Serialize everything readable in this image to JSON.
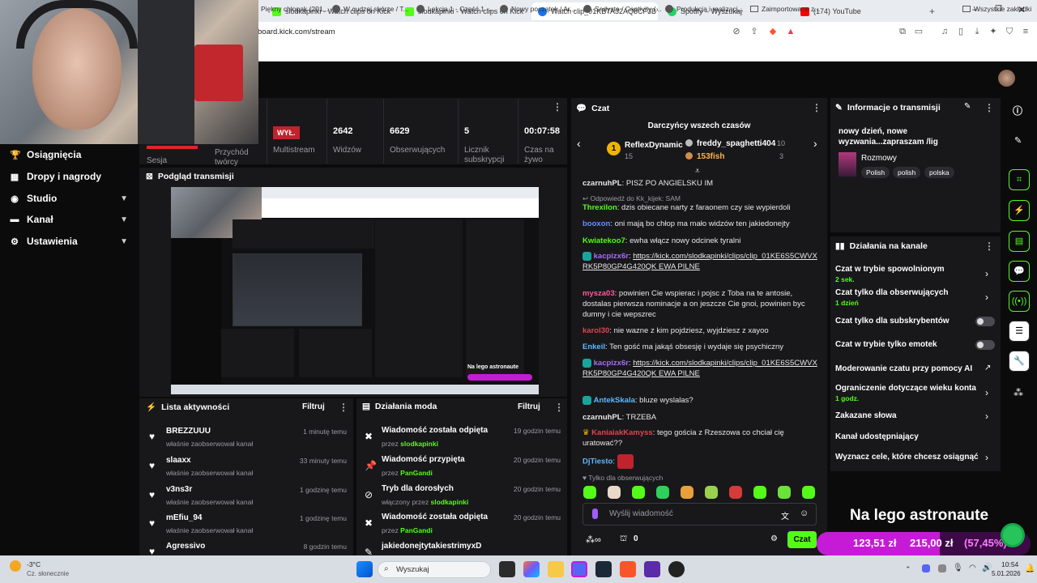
{
  "browser": {
    "tabs": [
      {
        "title": "slodkapinki - Watch clips on Kick"
      },
      {
        "title": "slodkapinki - Watch clips on Kick"
      },
      {
        "title": "Watch clip_01KBTA32AQ8CF3BYY8Z"
      },
      {
        "title": "Spotify – Wyszukaj"
      },
      {
        "title": "(174) YouTube"
      }
    ],
    "url": "board.kick.com/stream",
    "bookmarks": [
      "Piękny chłopak (201...",
      "W cudzej skórze / T...",
      "Lekcja 1 - Część 1 -...",
      "Nowy początek / Ar...",
      "Sadysta / Captivity (...",
      "Produkcja i realizacj...",
      "Zaimportowane z...",
      "Wszystkie zakładki"
    ]
  },
  "nav": {
    "items": [
      {
        "label": "Osiągnięcia",
        "icon": "trophy-icon"
      },
      {
        "label": "Dropy i nagrody",
        "icon": "gift-icon"
      },
      {
        "label": "Studio",
        "icon": "studio-icon"
      },
      {
        "label": "Kanał",
        "icon": "channel-icon"
      },
      {
        "label": "Ustawienia",
        "icon": "gear-icon"
      }
    ]
  },
  "stats": {
    "partial": [
      {
        "label": "Sesja"
      },
      {
        "label": "Przychód twórcy"
      }
    ],
    "items": [
      {
        "value": "WYŁ.",
        "label": "Multistream"
      },
      {
        "value": "2642",
        "label": "Widzów"
      },
      {
        "value": "6629",
        "label": "Obserwujących"
      },
      {
        "value": "5",
        "label": "Licznik subskrypcji"
      },
      {
        "value": "00:07:58",
        "label": "Czas na żywo"
      }
    ]
  },
  "preview": {
    "title": "Podgląd transmisji",
    "overlay_text": "Na lego astronaute"
  },
  "activity": {
    "title": "Lista aktywności",
    "filter": "Filtruj",
    "items": [
      {
        "name": "BREZZUUU",
        "sub": "właśnie zaobserwował kanał",
        "time": "1 minutę temu"
      },
      {
        "name": "slaaxx",
        "sub": "właśnie zaobserwował kanał",
        "time": "33 minuty temu"
      },
      {
        "name": "v3ns3r",
        "sub": "właśnie zaobserwował kanał",
        "time": "1 godzinę temu"
      },
      {
        "name": "mEfiu_94",
        "sub": "właśnie zaobserwował kanał",
        "time": "1 godzinę temu"
      },
      {
        "name": "Agressivo",
        "sub": "",
        "time": "8 godzin temu"
      }
    ]
  },
  "mod": {
    "title": "Działania moda",
    "filter": "Filtruj",
    "items": [
      {
        "name": "Wiadomość została odpięta",
        "by": "przez",
        "user": "slodkapinki",
        "time": "19 godzin temu"
      },
      {
        "name": "Wiadomość przypięta",
        "by": "przez",
        "user": "PanGandi",
        "time": "20 godzin temu"
      },
      {
        "name": "Tryb dla dorosłych",
        "by": "włączony przez",
        "user": "slodkapinki",
        "time": "20 godzin temu"
      },
      {
        "name": "Wiadomość została odpięta",
        "by": "przez",
        "user": "PanGandi",
        "time": "20 godzin temu"
      },
      {
        "name": "jakiedonejtytakiestrimyxD",
        "by": "",
        "user": "",
        "time": ""
      }
    ]
  },
  "chat": {
    "title": "Czat",
    "donors_title": "Darczyńcy wszech czasów",
    "donors": [
      {
        "rank": "1",
        "name": "ReflexDynamic",
        "amount": "15"
      },
      {
        "name": "freddy_spaghetti404",
        "amount": "10"
      },
      {
        "name": "153fish",
        "amount": "3"
      }
    ],
    "messages": [
      {
        "user": "czarnuhPL",
        "color": "#e8e8ea",
        "text": "PISZ PO ANGIELSKU IM"
      },
      {
        "user": "",
        "color": "#9a9aa0",
        "text": "Odpowiedź do Kk_kijek: SAM"
      },
      {
        "user": "Threxilon",
        "color": "#53fc18",
        "text": "dzis obiecane narty z faraonem czy sie wypierdoli"
      },
      {
        "user": "booxon",
        "color": "#6a8cff",
        "text": "oni mają bo chłop ma mało widzów ten jakiedonejty"
      },
      {
        "user": "Kwiatekoo7",
        "color": "#53fc18",
        "text": "ewha włącz nowy odcinek tyralni"
      },
      {
        "user": "kacpizx6r",
        "color": "#a66bff",
        "text": "https://kick.com/slodkapinki/clips/clip_01KE6S5CWVXRK5P80GP4G420QK EWA PILNE"
      },
      {
        "user": "mysza03",
        "color": "#ff5a9b",
        "text": "powinien Cie wspierac i pojsc z Toba na te antosie, dostalas pierwsza nominacje a on jeszcze Cie gnoi, powinien byc dumny i cie wepszrec"
      },
      {
        "user": "karol30",
        "color": "#e0454f",
        "text": "nie wazne z kim pojdziesz, wyjdziesz z xayoo"
      },
      {
        "user": "Enkeil",
        "color": "#5fb8ff",
        "text": "Ten gość ma jakąś obsesję i wydaje się psychiczny"
      },
      {
        "user": "kacpizx6r",
        "color": "#a66bff",
        "text": "https://kick.com/slodkapinki/clips/clip_01KE6S5CWVXRK5P80GP4G420QK EWA PILNE"
      },
      {
        "user": "AntekSkala",
        "color": "#5fb8ff",
        "text": "bluze wyslalas?"
      },
      {
        "user": "czarnuhPL",
        "color": "#e8e8ea",
        "text": "TRZEBA"
      },
      {
        "user": "KaniaiakKamyss",
        "color": "#e0454f",
        "text": "tego gościa z Rzeszowa co chciał cię uratować??"
      },
      {
        "user": "DjTiesto",
        "color": "#5fb8ff",
        "text": ""
      }
    ],
    "followers_only": "Tylko dla obserwujących",
    "input_placeholder": "Wyślij wiadomość",
    "count": "0",
    "send": "Czat"
  },
  "info": {
    "title": "Informacje o transmisji",
    "stream_title": "nowy dzień, nowe wyzwania...zapraszam /lig",
    "category": "Rozmowy",
    "tags": [
      "Polish",
      "polish",
      "polska"
    ]
  },
  "channel_actions": {
    "title": "Działania na kanale",
    "items": [
      {
        "label": "Czat w trybie spowolnionym",
        "sub": "2 sek.",
        "control": "arrow"
      },
      {
        "label": "Czat tylko dla obserwujących",
        "sub": "1 dzień",
        "control": "arrow"
      },
      {
        "label": "Czat tylko dla subskrybentów",
        "sub": "",
        "control": "toggle"
      },
      {
        "label": "Czat w trybie tylko emotek",
        "sub": "",
        "control": "toggle"
      },
      {
        "label": "Moderowanie czatu przy pomocy AI",
        "sub": "",
        "control": "external"
      },
      {
        "label": "Ograniczenie dotyczące wieku konta",
        "sub": "1 godz.",
        "control": "arrow"
      },
      {
        "label": "Zakazane słowa",
        "sub": "",
        "control": "arrow"
      },
      {
        "label": "Kanał udostępniający",
        "sub": "",
        "control": "none"
      },
      {
        "label": "Wyznacz cele, które chcesz osiągnąć",
        "sub": "",
        "control": "arrow"
      }
    ]
  },
  "overlay": {
    "title": "Na lego astronaute",
    "amount1": "123,51 zł",
    "amount2": "215,00 zł",
    "percent": "(57,45%)",
    "progress": 57.45
  },
  "taskbar": {
    "weather_temp": "-3°C",
    "weather_desc": "Cz. słonecznie",
    "search": "Wyszukaj",
    "time": "10:54",
    "date": "5.01.2026"
  },
  "colors": {
    "accent": "#53fc18",
    "panel": "#18181b",
    "bg": "#0b0b0c",
    "pink": "#c51bd6"
  }
}
